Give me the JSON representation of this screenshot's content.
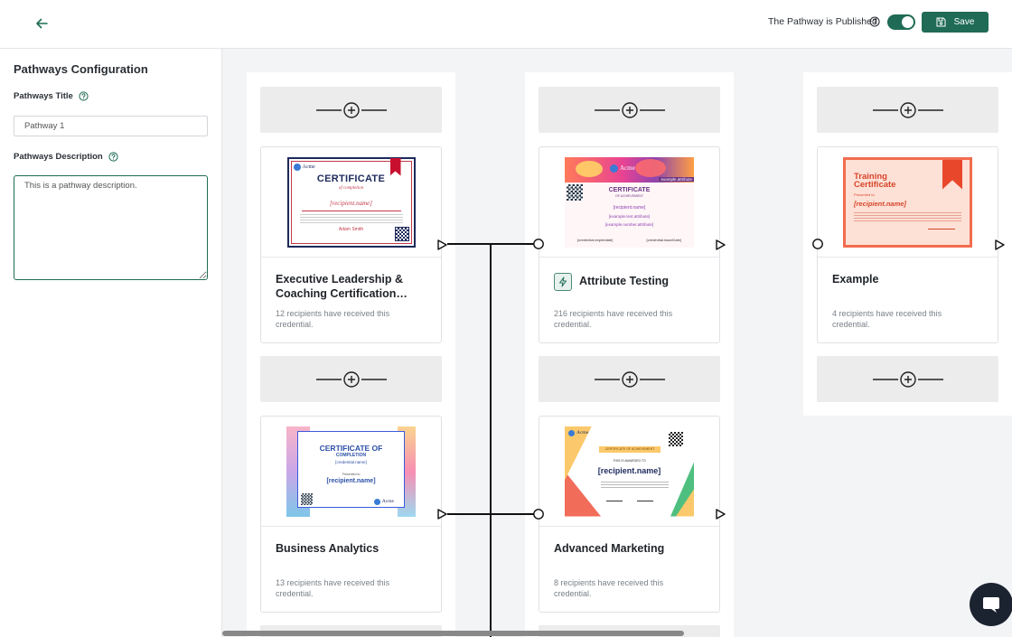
{
  "header": {
    "published_label": "The Pathway is Published",
    "published": true,
    "save_label": "Save",
    "accent": "#1f6b55"
  },
  "sidebar": {
    "title": "Pathways Configuration",
    "title_label": "Pathways Title",
    "title_value": "Pathway 1",
    "description_label": "Pathways Description",
    "description_value": "This is a pathway description."
  },
  "cards": [
    {
      "name": "Executive Leadership & Coaching Certification…",
      "count": "12 recipients have received this credential.",
      "cert": {
        "brand": "Acme",
        "heading": "CERTIFICATE",
        "sub": "of completion",
        "recipient": "[recipient.name]",
        "signer": "Adam Smith"
      }
    },
    {
      "name": "Attribute Testing",
      "count": "216 recipients have received this credential.",
      "cert": {
        "brand": "Acme",
        "heading": "CERTIFICATE",
        "sub": "OF ACHIEVEMENT",
        "recipient": "[recipient.name]",
        "attr1": "[example.text.attribute]",
        "attr2": "[example.number.attribute]",
        "date1": "[credential.expiredate]",
        "date2": "[credential.issueDate]",
        "badge": "example.attribute"
      }
    },
    {
      "name": "Example",
      "count": "4 recipients have received this credential.",
      "cert": {
        "heading": "Training Certificate",
        "sub": "Presented to",
        "recipient": "[recipient.name]"
      }
    },
    {
      "name": "Business Analytics",
      "count": "13 recipients have received this credential.",
      "cert": {
        "heading": "CERTIFICATE OF",
        "heading2": "COMPLETION",
        "credential": "[credential.name]",
        "sub": "Presented to",
        "recipient": "[recipient.name]",
        "brand": "Acme"
      }
    },
    {
      "name": "Advanced Marketing",
      "count": "8 recipients have received this credential.",
      "cert": {
        "brand": "Acme",
        "banner": "CERTIFICATE OF ACHIEVEMENT",
        "sub": "THIS IS AWARDED TO",
        "recipient": "[recipient.name]"
      }
    }
  ]
}
